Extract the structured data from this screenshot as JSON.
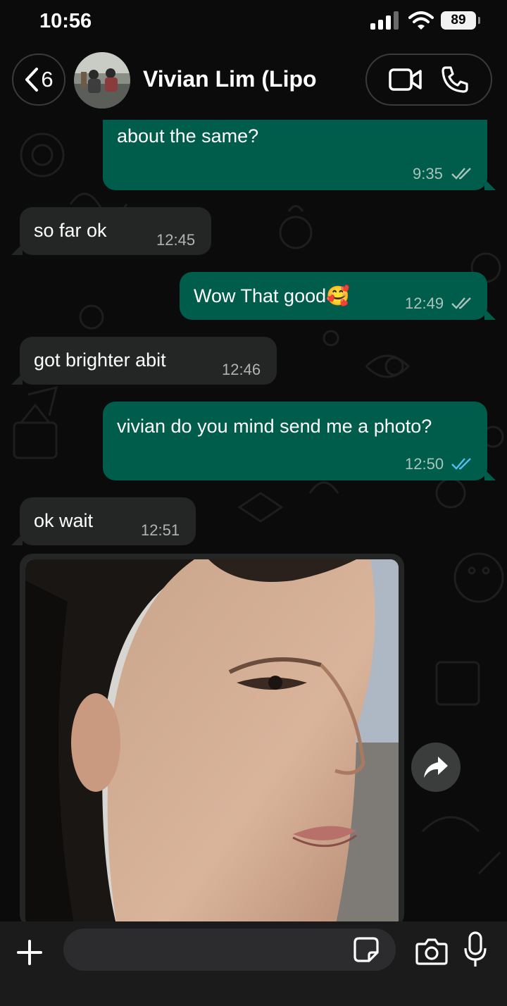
{
  "status_bar": {
    "time": "10:56",
    "battery": "89"
  },
  "header": {
    "back_count": "6",
    "contact_name": "Vivian Lim (Lipo"
  },
  "messages": [
    {
      "direction": "outgoing",
      "text": "about the same?",
      "time": "9:35",
      "status": "read-grey"
    },
    {
      "direction": "incoming",
      "text": "so far ok",
      "time": "12:45"
    },
    {
      "direction": "outgoing",
      "text": "Wow That good🥰",
      "time": "12:49",
      "status": "read-grey"
    },
    {
      "direction": "incoming",
      "text": "got brighter abit",
      "time": "12:46"
    },
    {
      "direction": "outgoing",
      "text": "vivian do you mind send me a photo?",
      "time": "12:50",
      "status": "read-blue"
    },
    {
      "direction": "incoming",
      "text": "ok wait",
      "time": "12:51"
    },
    {
      "direction": "incoming",
      "type": "photo",
      "description_icon": "photo-thumbnail"
    }
  ],
  "composer": {
    "placeholder": ""
  },
  "colors": {
    "outgoing_bubble": "#005c4b",
    "incoming_bubble": "#242626",
    "read_blue": "#53bdeb",
    "background": "#0b0b0b"
  }
}
